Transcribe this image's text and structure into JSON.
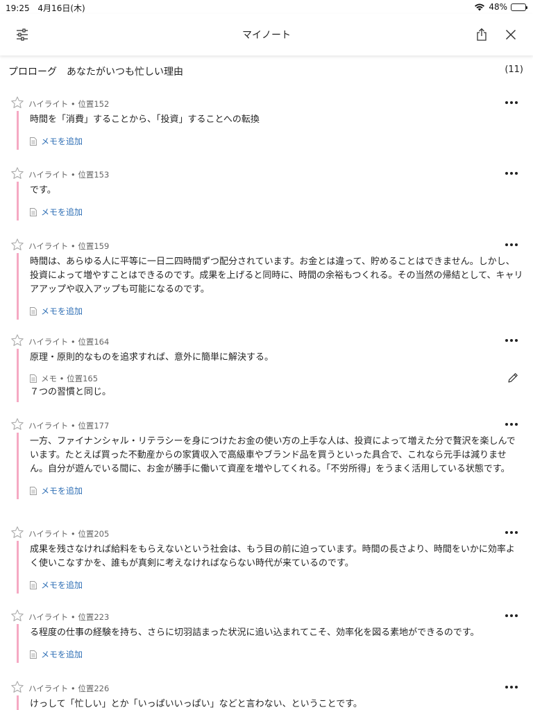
{
  "status": {
    "time": "19:25",
    "date": "4月16日(木)",
    "battery": "48%",
    "battery_level": 0.48
  },
  "nav": {
    "title": "マイノート"
  },
  "chapter": {
    "title": "プロローグ　あなたがいつも忙しい理由",
    "count": "(11)"
  },
  "add_memo_label": "メモを追加",
  "notes": [
    {
      "meta": "ハイライト • 位置152",
      "text": "時間を「消費」することから、「投資」することへの転換"
    },
    {
      "meta": "ハイライト • 位置153",
      "text": "です。"
    },
    {
      "meta": "ハイライト • 位置159",
      "text": "時間は、あらゆる人に平等に一日二四時間ずつ配分されています。お金とは違って、貯めることはできません。しかし、投資によって増やすことはできるのです。成果を上げると同時に、時間の余裕もつくれる。その当然の帰結として、キャリアアップや収入アップも可能になるのです。"
    },
    {
      "meta": "ハイライト • 位置164",
      "text": "原理・原則的なものを追求すれば、意外に簡単に解決する。",
      "memo_meta": "メモ • 位置165",
      "memo_text": "７つの習慣と同じ。"
    },
    {
      "meta": "ハイライト • 位置177",
      "text": "一方、ファイナンシャル・リテラシーを身につけたお金の使い方の上手な人は、投資によって増えた分で贅沢を楽しんでいます。たとえば買った不動産からの家賃収入で高級車やブランド品を買うといった具合で、これなら元手は減りません。自分が遊んでいる間に、お金が勝手に働いて資産を増やしてくれる。「不労所得」をうまく活用している状態です。"
    },
    {
      "meta": "ハイライト • 位置205",
      "text": "成果を残さなければ給料をもらえないという社会は、もう目の前に迫っています。時間の長さより、時間をいかに効率よく使いこなすかを、誰もが真剣に考えなければならない時代が来ているのです。"
    },
    {
      "meta": "ハイライト • 位置223",
      "text": "る程度の仕事の経験を持ち、さらに切羽詰まった状況に追い込まれてこそ、効率化を図る素地ができるのです。"
    },
    {
      "meta": "ハイライト • 位置226",
      "text": "けっして「忙しい」とか「いっぱいいっぱい」などと言わない、ということです。"
    }
  ]
}
